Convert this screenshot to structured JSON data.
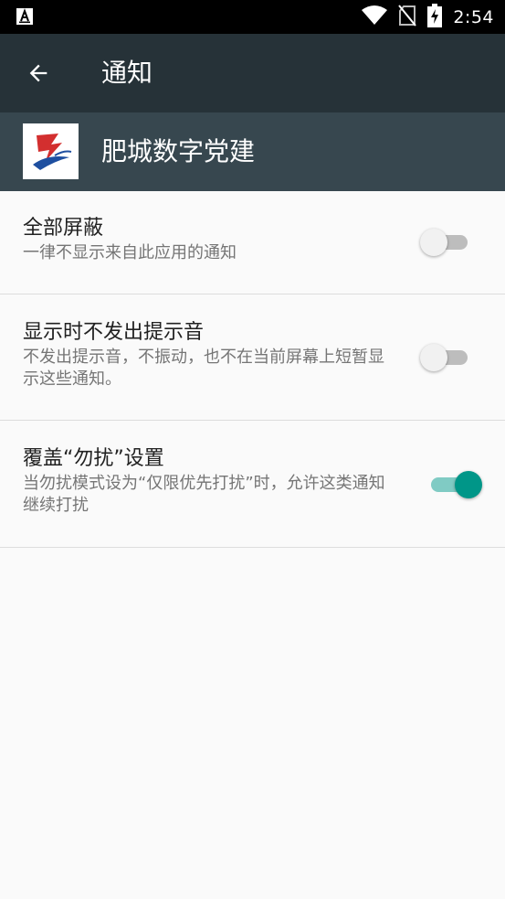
{
  "status_bar": {
    "time": "2:54",
    "left_icon": "app-notification-icon",
    "icons": [
      "wifi-icon",
      "no-sim-icon",
      "battery-charging-icon"
    ]
  },
  "toolbar": {
    "back_icon": "arrow-back-icon",
    "title": "通知"
  },
  "app_header": {
    "app_name": "肥城数字党建",
    "app_icon": "party-building-logo-icon"
  },
  "settings": [
    {
      "title": "全部屏蔽",
      "summary": "一律不显示来自此应用的通知",
      "enabled": false
    },
    {
      "title": "显示时不发出提示音",
      "summary": "不发出提示音，不振动，也不在当前屏幕上短暂显示这些通知。",
      "enabled": false
    },
    {
      "title": "覆盖“勿扰”设置",
      "summary": "当勿扰模式设为“仅限优先打扰”时，允许这类通知继续打扰",
      "enabled": true
    }
  ],
  "colors": {
    "status_bar": "#000000",
    "toolbar": "#263238",
    "app_header": "#37474f",
    "accent": "#009688",
    "background": "#fafafa"
  }
}
